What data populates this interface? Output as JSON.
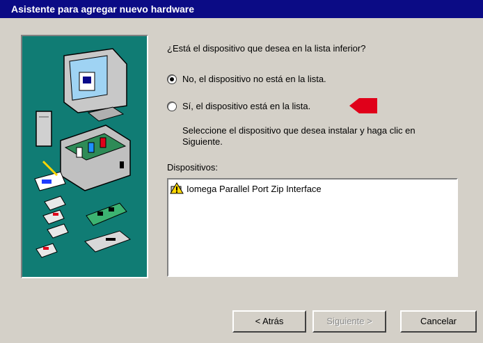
{
  "window": {
    "title": "Asistente para agregar nuevo hardware"
  },
  "question": "¿Está el dispositivo que desea en la lista inferior?",
  "options": [
    {
      "label": "No, el dispositivo no está en la lista.",
      "selected": true
    },
    {
      "label": "Sí, el dispositivo está en la lista.",
      "selected": false
    }
  ],
  "description": "Seleccione el dispositivo que desea instalar y haga clic en Siguiente.",
  "devices_label": "Dispositivos:",
  "devices": [
    {
      "name": "Iomega Parallel Port Zip Interface",
      "icon": "warning-device-icon"
    }
  ],
  "buttons": {
    "back": "< Atrás",
    "next": "Siguiente >",
    "cancel": "Cancelar"
  },
  "colors": {
    "titlebar": "#0b0b85",
    "illustration_bg": "#107c74",
    "arrow": "#e0001a",
    "window_bg": "#d4d0c8"
  }
}
